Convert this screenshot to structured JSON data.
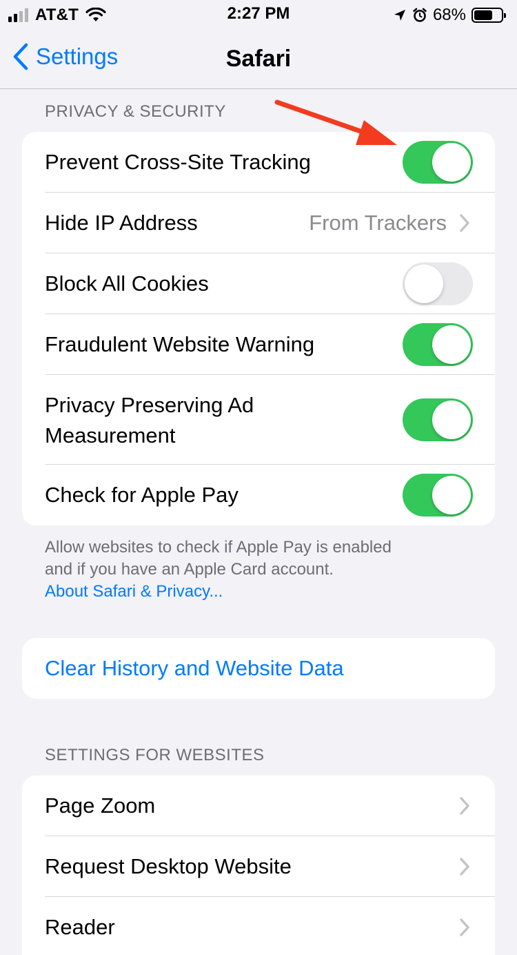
{
  "status_bar": {
    "carrier": "AT&T",
    "time": "2:27 PM",
    "battery_percent": "68%",
    "battery_level": 0.68
  },
  "nav": {
    "back_label": "Settings",
    "title": "Safari"
  },
  "privacy": {
    "header": "PRIVACY & SECURITY",
    "rows": [
      {
        "label": "Prevent Cross-Site Tracking",
        "toggle": true
      },
      {
        "label": "Hide IP Address",
        "detail": "From Trackers"
      },
      {
        "label": "Block All Cookies",
        "toggle": false
      },
      {
        "label": "Fraudulent Website Warning",
        "toggle": true
      },
      {
        "label_line1": "Privacy Preserving Ad",
        "label_line2": "Measurement",
        "toggle": true
      },
      {
        "label": "Check for Apple Pay",
        "toggle": true
      }
    ],
    "footer_line1": "Allow websites to check if Apple Pay is enabled",
    "footer_line2": "and if you have an Apple Card account.",
    "footer_link": "About Safari & Privacy..."
  },
  "clear": {
    "label": "Clear History and Website Data"
  },
  "websites": {
    "header": "SETTINGS FOR WEBSITES",
    "rows": [
      {
        "label": "Page Zoom"
      },
      {
        "label": "Request Desktop Website"
      },
      {
        "label": "Reader"
      }
    ]
  },
  "colors": {
    "accent": "#007aff",
    "toggle_on": "#34c759",
    "toggle_off": "#e9e9eb",
    "annotation_arrow": "#f23b1f",
    "background": "#f2f2f7"
  }
}
